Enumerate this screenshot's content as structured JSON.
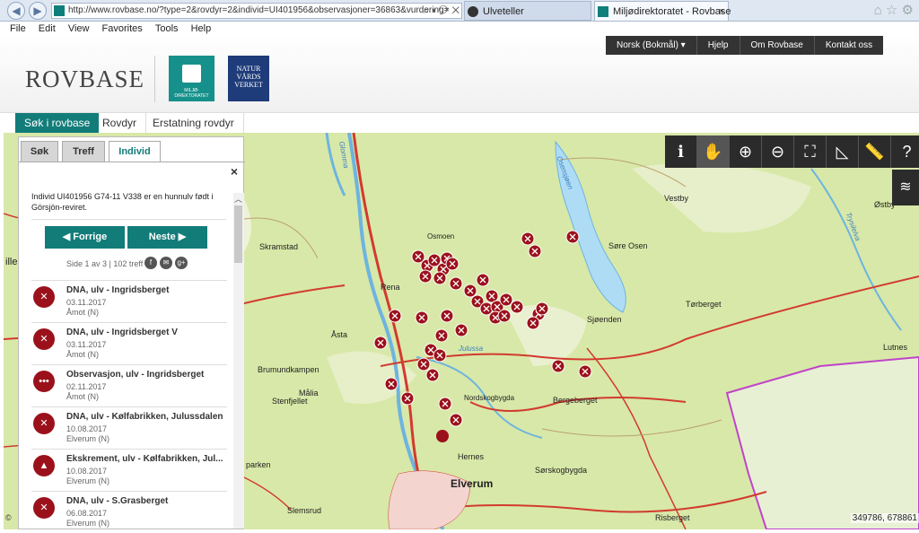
{
  "browser": {
    "url": "http://www.rovbase.no/?type=2&rovdyr=2&individ=UI401956&observasjoner=36863&vurdering=",
    "tabs": [
      {
        "label": "Ulveteller"
      },
      {
        "label": "Miljødirektoratet - Rovbase",
        "close": "×"
      }
    ],
    "menu": [
      "File",
      "Edit",
      "View",
      "Favorites",
      "Tools",
      "Help"
    ]
  },
  "site": {
    "top_nav": [
      "Norsk (Bokmål) ▾",
      "Hjelp",
      "Om Rovbase",
      "Kontakt oss"
    ],
    "logo": "ROVBASE",
    "md_logo": "MILJØ-DIREKTORATET",
    "nv_logo": [
      "NATUR",
      "VÅRDS",
      "VERKET"
    ],
    "tabs": [
      "Søk i rovbase",
      "Rovdyr",
      "Erstatning rovdyr"
    ]
  },
  "panel": {
    "tabs": [
      "Søk",
      "Treff",
      "Individ"
    ],
    "close": "×",
    "description": "Individ UI401956 G74-11 V338 er en hunnulv født i Görsjön-reviret.",
    "prev": "◀ Forrige",
    "next": "Neste ▶",
    "pager": "Side 1 av 3 | 102 treff",
    "share_icons": [
      "f",
      "✉",
      "g+"
    ],
    "results": [
      {
        "title": "DNA, ulv - Ingridsberget",
        "date": "03.11.2017",
        "place": "Åmot (N)",
        "icon": "dna-icon"
      },
      {
        "title": "DNA, ulv - Ingridsberget V",
        "date": "03.11.2017",
        "place": "Åmot (N)",
        "icon": "dna-icon"
      },
      {
        "title": "Observasjon, ulv - Ingridsberget",
        "date": "02.11.2017",
        "place": "Åmot (N)",
        "icon": "observation-icon"
      },
      {
        "title": "DNA, ulv - Kølfabrikken, Julussdalen",
        "date": "10.08.2017",
        "place": "Elverum (N)",
        "icon": "dna-icon"
      },
      {
        "title": "Ekskrement, ulv - Kølfabrikken, Jul...",
        "date": "10.08.2017",
        "place": "Elverum (N)",
        "icon": "scat-icon"
      },
      {
        "title": "DNA, ulv - S.Grasberget",
        "date": "06.08.2017",
        "place": "Elverum (N)",
        "icon": "dna-icon"
      }
    ]
  },
  "map": {
    "coords": "349786, 678861",
    "copyright": "©",
    "tools": [
      "ℹ",
      "✋",
      "⊕",
      "⊖",
      "⛶",
      "◺",
      "📏",
      "?"
    ],
    "layers_icon": "≋",
    "labels": [
      "fjellet",
      "Skramstad",
      "Rena",
      "Åsta",
      "Brumundkampen",
      "Målia",
      "Stenfjellet",
      "Osmoen",
      "Vestby",
      "Østby",
      "Søre Osen",
      "Tørberget",
      "Sjøenden",
      "Lutnes",
      "Nordskogbygda",
      "Bergeberget",
      "Hernes",
      "Sørskogbygda",
      "Elverum",
      "Risberget",
      "Slemsrud",
      "parken",
      "Julussa",
      "Glomma",
      "Osensjøen",
      "Trysilelva",
      "ille"
    ]
  }
}
